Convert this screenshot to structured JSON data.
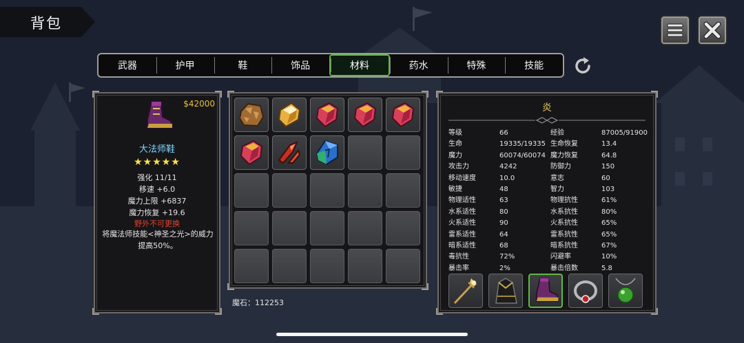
{
  "header": {
    "title": "背包"
  },
  "tabs": [
    {
      "label": "武器",
      "active": false
    },
    {
      "label": "护甲",
      "active": false
    },
    {
      "label": "鞋",
      "active": false
    },
    {
      "label": "饰品",
      "active": false
    },
    {
      "label": "材料",
      "active": true
    },
    {
      "label": "药水",
      "active": false
    },
    {
      "label": "特殊",
      "active": false
    },
    {
      "label": "技能",
      "active": false
    }
  ],
  "icons": {
    "menu": "menu-icon",
    "close": "close-icon",
    "refresh": "refresh-icon"
  },
  "item": {
    "price": "$42000",
    "name": "大法师鞋",
    "stars": "★★★★★",
    "stats": [
      "强化 11/11",
      "移速  +6.0",
      "魔力上限  +6837",
      "魔力恢复  +19.6"
    ],
    "warning": "野外不可更换",
    "description": "将魔法师技能<神圣之光>的威力提高50%。"
  },
  "inventory": {
    "slots": [
      "stone-ore",
      "amber-crystal",
      "red-crystal",
      "red-crystal",
      "red-crystal",
      "red-crystal",
      "red-shard",
      "blue-green-crystal",
      "",
      "",
      "",
      "",
      "",
      "",
      "",
      "",
      "",
      "",
      "",
      "",
      "",
      "",
      "",
      "",
      ""
    ],
    "currency_label": "魔石：112253"
  },
  "character": {
    "name": "炎",
    "stats": [
      [
        "等级",
        "66",
        "经验",
        "87005/91900"
      ],
      [
        "生命",
        "19335/19335",
        "生命恢复",
        "13.4"
      ],
      [
        "魔力",
        "60074/60074",
        "魔力恢复",
        "64.8"
      ],
      [
        "攻击力",
        "4242",
        "防御力",
        "150"
      ],
      [
        "移动速度",
        "10.0",
        "意志",
        "60"
      ],
      [
        "敏捷",
        "48",
        "智力",
        "103"
      ],
      [
        "物理适性",
        "63",
        "物理抗性",
        "61%"
      ],
      [
        "水系适性",
        "80",
        "水系抗性",
        "80%"
      ],
      [
        "火系适性",
        "90",
        "火系抗性",
        "65%"
      ],
      [
        "雷系适性",
        "64",
        "雷系抗性",
        "65%"
      ],
      [
        "暗系适性",
        "68",
        "暗系抗性",
        "67%"
      ],
      [
        "毒抗性",
        "72%",
        "闪避率",
        "10%"
      ],
      [
        "暴击率",
        "2%",
        "暴击倍数",
        "5.8"
      ]
    ],
    "equipment": [
      "staff-icon",
      "robe-icon",
      "boots-icon",
      "ring-icon",
      "necklace-icon"
    ],
    "selected_equipment": 2
  },
  "colors": {
    "accent_green": "#61b844",
    "price_gold": "#e8c040",
    "item_name_cyan": "#7dd8ff",
    "warning_red": "#e0432f",
    "star_yellow": "#ffe24a"
  }
}
